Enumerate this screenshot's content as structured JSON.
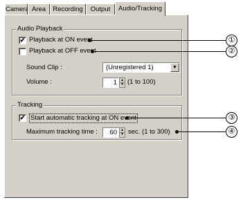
{
  "tabs": [
    {
      "label": "Camera"
    },
    {
      "label": "Area"
    },
    {
      "label": "Recording"
    },
    {
      "label": "Output"
    },
    {
      "label": "Audio/Tracking"
    }
  ],
  "audio_playback": {
    "title": "Audio Playback",
    "on_event": {
      "label": "Playback at ON event",
      "checked": true
    },
    "off_event": {
      "label": "Playback at OFF event",
      "checked": false
    },
    "sound_clip": {
      "label": "Sound Clip :",
      "value": "(Unregistered 1)"
    },
    "volume": {
      "label": "Volume :",
      "value": "1",
      "range": "(1 to 100)"
    }
  },
  "tracking": {
    "title": "Tracking",
    "auto": {
      "label": "Start automatic tracking at ON event",
      "checked": true
    },
    "max_time": {
      "label": "Maximum tracking time :",
      "value": "60",
      "unit": "sec. (1 to 300)"
    }
  },
  "callouts": [
    "①",
    "②",
    "③",
    "④"
  ],
  "check_glyph": "✔",
  "icons": {
    "dropdown": "chevron-down-icon",
    "spin_up": "up-arrow-icon",
    "spin_down": "down-arrow-icon"
  }
}
